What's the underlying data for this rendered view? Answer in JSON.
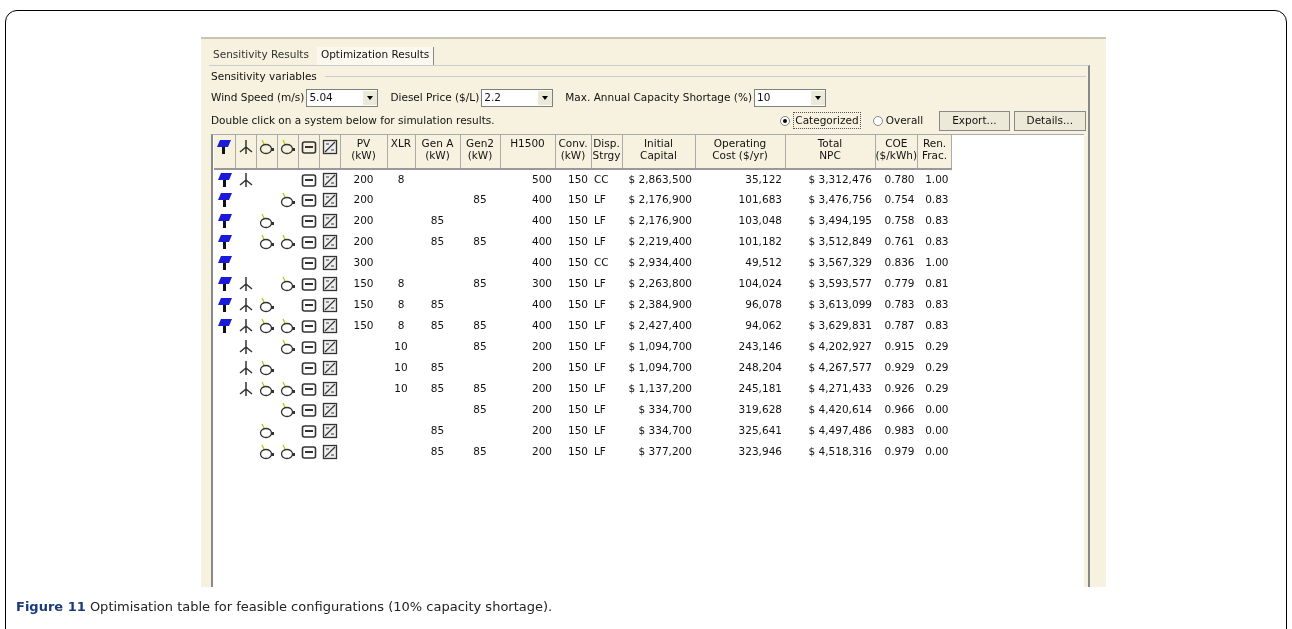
{
  "tabs": [
    {
      "label": "Sensitivity Results",
      "selected": false
    },
    {
      "label": "Optimization Results",
      "selected": true
    }
  ],
  "group_label": "Sensitivity variables",
  "dropdowns": [
    {
      "label": "Wind Speed (m/s)",
      "value": "5.04"
    },
    {
      "label": "Diesel Price ($/L)",
      "value": "2.2"
    },
    {
      "label": "Max. Annual Capacity Shortage (%)",
      "value": "10"
    }
  ],
  "hint": "Double click on a system below for simulation results.",
  "radios": [
    {
      "label": "Categorized",
      "selected": true
    },
    {
      "label": "Overall",
      "selected": false
    }
  ],
  "buttons": [
    "Export...",
    "Details..."
  ],
  "table": {
    "icon_columns": [
      {
        "kind": "pv"
      },
      {
        "kind": "wind"
      },
      {
        "kind": "gen_a"
      },
      {
        "kind": "gen_2"
      },
      {
        "kind": "battery"
      },
      {
        "kind": "converter"
      }
    ],
    "columns": [
      "PV\n(kW)",
      "XLR",
      "Gen A\n(kW)",
      "Gen2\n(kW)",
      "H1500",
      "Conv.\n(kW)",
      "Disp.\nStrgy",
      "Initial\nCapital",
      "Operating\nCost ($/yr)",
      "Total\nNPC",
      "COE\n($/kWh)",
      "Ren.\nFrac."
    ],
    "rows": [
      {
        "pv": true,
        "wind": true,
        "gen_a": false,
        "gen_2": false,
        "battery": true,
        "converter": true,
        "cells": [
          "200",
          "8",
          "",
          "",
          "500",
          "150",
          "CC",
          "$ 2,863,500",
          "35,122",
          "$ 3,312,476",
          "0.780",
          "1.00"
        ]
      },
      {
        "pv": true,
        "wind": false,
        "gen_a": false,
        "gen_2": true,
        "battery": true,
        "converter": true,
        "cells": [
          "200",
          "",
          "",
          "85",
          "400",
          "150",
          "LF",
          "$ 2,176,900",
          "101,683",
          "$ 3,476,756",
          "0.754",
          "0.83"
        ]
      },
      {
        "pv": true,
        "wind": false,
        "gen_a": true,
        "gen_2": false,
        "battery": true,
        "converter": true,
        "cells": [
          "200",
          "",
          "85",
          "",
          "400",
          "150",
          "LF",
          "$ 2,176,900",
          "103,048",
          "$ 3,494,195",
          "0.758",
          "0.83"
        ]
      },
      {
        "pv": true,
        "wind": false,
        "gen_a": true,
        "gen_2": true,
        "battery": true,
        "converter": true,
        "cells": [
          "200",
          "",
          "85",
          "85",
          "400",
          "150",
          "LF",
          "$ 2,219,400",
          "101,182",
          "$ 3,512,849",
          "0.761",
          "0.83"
        ]
      },
      {
        "pv": true,
        "wind": false,
        "gen_a": false,
        "gen_2": false,
        "battery": true,
        "converter": true,
        "cells": [
          "300",
          "",
          "",
          "",
          "400",
          "150",
          "CC",
          "$ 2,934,400",
          "49,512",
          "$ 3,567,329",
          "0.836",
          "1.00"
        ]
      },
      {
        "pv": true,
        "wind": true,
        "gen_a": false,
        "gen_2": true,
        "battery": true,
        "converter": true,
        "cells": [
          "150",
          "8",
          "",
          "85",
          "300",
          "150",
          "LF",
          "$ 2,263,800",
          "104,024",
          "$ 3,593,577",
          "0.779",
          "0.81"
        ]
      },
      {
        "pv": true,
        "wind": true,
        "gen_a": true,
        "gen_2": false,
        "battery": true,
        "converter": true,
        "cells": [
          "150",
          "8",
          "85",
          "",
          "400",
          "150",
          "LF",
          "$ 2,384,900",
          "96,078",
          "$ 3,613,099",
          "0.783",
          "0.83"
        ]
      },
      {
        "pv": true,
        "wind": true,
        "gen_a": true,
        "gen_2": true,
        "battery": true,
        "converter": true,
        "cells": [
          "150",
          "8",
          "85",
          "85",
          "400",
          "150",
          "LF",
          "$ 2,427,400",
          "94,062",
          "$ 3,629,831",
          "0.787",
          "0.83"
        ]
      },
      {
        "pv": false,
        "wind": true,
        "gen_a": false,
        "gen_2": true,
        "battery": true,
        "converter": true,
        "cells": [
          "",
          "10",
          "",
          "85",
          "200",
          "150",
          "LF",
          "$ 1,094,700",
          "243,146",
          "$ 4,202,927",
          "0.915",
          "0.29"
        ]
      },
      {
        "pv": false,
        "wind": true,
        "gen_a": true,
        "gen_2": false,
        "battery": true,
        "converter": true,
        "cells": [
          "",
          "10",
          "85",
          "",
          "200",
          "150",
          "LF",
          "$ 1,094,700",
          "248,204",
          "$ 4,267,577",
          "0.929",
          "0.29"
        ]
      },
      {
        "pv": false,
        "wind": true,
        "gen_a": true,
        "gen_2": true,
        "battery": true,
        "converter": true,
        "cells": [
          "",
          "10",
          "85",
          "85",
          "200",
          "150",
          "LF",
          "$ 1,137,200",
          "245,181",
          "$ 4,271,433",
          "0.926",
          "0.29"
        ]
      },
      {
        "pv": false,
        "wind": false,
        "gen_a": false,
        "gen_2": true,
        "battery": true,
        "converter": true,
        "cells": [
          "",
          "",
          "",
          "85",
          "200",
          "150",
          "LF",
          "$ 334,700",
          "319,628",
          "$ 4,420,614",
          "0.966",
          "0.00"
        ]
      },
      {
        "pv": false,
        "wind": false,
        "gen_a": true,
        "gen_2": false,
        "battery": true,
        "converter": true,
        "cells": [
          "",
          "",
          "85",
          "",
          "200",
          "150",
          "LF",
          "$ 334,700",
          "325,641",
          "$ 4,497,486",
          "0.983",
          "0.00"
        ]
      },
      {
        "pv": false,
        "wind": false,
        "gen_a": true,
        "gen_2": true,
        "battery": true,
        "converter": true,
        "cells": [
          "",
          "",
          "85",
          "85",
          "200",
          "150",
          "LF",
          "$ 377,200",
          "323,946",
          "$ 4,518,316",
          "0.979",
          "0.00"
        ]
      }
    ]
  },
  "caption": {
    "label": "Figure 11",
    "text": "Optimisation table for feasible configurations (10% capacity shortage)."
  }
}
